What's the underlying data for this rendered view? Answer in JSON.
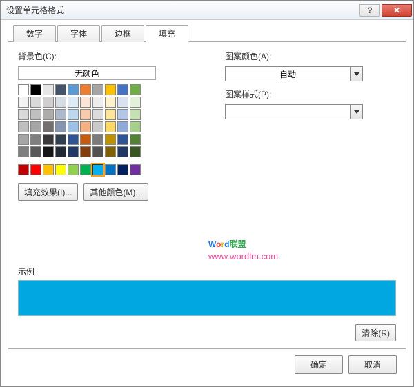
{
  "title": "设置单元格格式",
  "titlebar": {
    "help": "?",
    "close": "✕"
  },
  "tabs": {
    "number": "数字",
    "font": "字体",
    "border": "边框",
    "fill": "填充"
  },
  "left": {
    "bgcolor_label": "背景色(C):",
    "nocolor": "无颜色",
    "fill_effects": "填充效果(I)...",
    "other_colors": "其他颜色(M)..."
  },
  "right": {
    "pattern_color_label": "图案颜色(A):",
    "pattern_color_value": "自动",
    "pattern_style_label": "图案样式(P):",
    "pattern_style_value": ""
  },
  "palette": {
    "rows": [
      [
        "#ffffff",
        "#000000",
        "#e7e6e6",
        "#44546a",
        "#5b9bd5",
        "#ed7d31",
        "#a5a5a5",
        "#ffc000",
        "#4472c4",
        "#70ad47"
      ],
      [
        "#f2f2f2",
        "#d9d9d9",
        "#d0cece",
        "#d6dce4",
        "#deebf6",
        "#fce4d6",
        "#ededed",
        "#fff2cc",
        "#d9e2f3",
        "#e2efd9"
      ],
      [
        "#d8d8d8",
        "#bfbfbf",
        "#aeabab",
        "#adb9ca",
        "#bdd7ee",
        "#f8cbad",
        "#dbdbdb",
        "#fee599",
        "#b4c6e7",
        "#c5e0b3"
      ],
      [
        "#bfbfbf",
        "#a5a5a5",
        "#757070",
        "#8496b0",
        "#9cc3e5",
        "#f4b183",
        "#c9c9c9",
        "#ffd965",
        "#8eaadb",
        "#a8d08d"
      ],
      [
        "#a5a5a5",
        "#7f7f7f",
        "#3a3838",
        "#323f4f",
        "#2f5496",
        "#c55a11",
        "#7b7b7b",
        "#bf9000",
        "#2f5496",
        "#538135"
      ],
      [
        "#7f7f7f",
        "#595959",
        "#171616",
        "#222a35",
        "#1f3864",
        "#833c0b",
        "#525252",
        "#7f6000",
        "#1f3864",
        "#375623"
      ]
    ],
    "std": [
      "#c00000",
      "#ff0000",
      "#ffc000",
      "#ffff00",
      "#92d050",
      "#00b050",
      "#00b0f0",
      "#0070c0",
      "#002060",
      "#7030a0"
    ],
    "selected": "#00b0f0"
  },
  "sample": {
    "label": "示例",
    "color": "#00a7e1"
  },
  "buttons": {
    "clear": "清除(R)",
    "ok": "确定",
    "cancel": "取消"
  },
  "watermark": {
    "line1_word": "Word",
    "line1_suffix": "联盟",
    "line2": "www.wordlm.com"
  }
}
